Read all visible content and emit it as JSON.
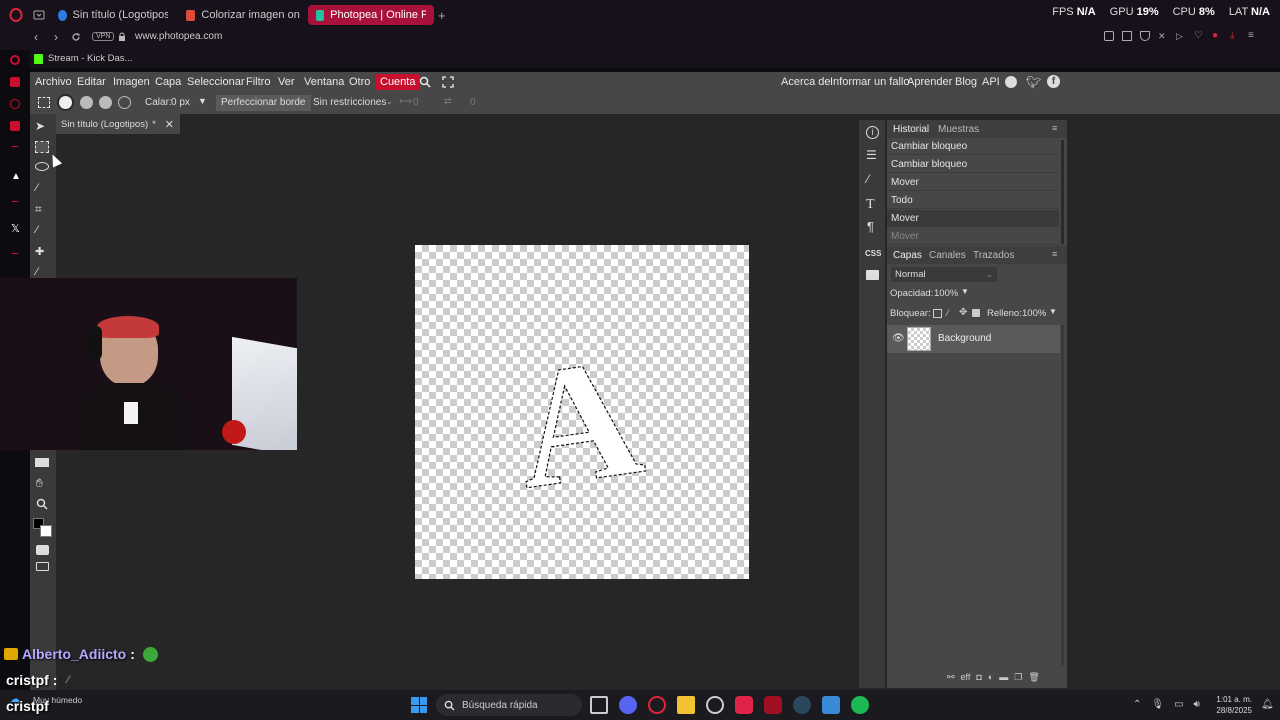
{
  "browser": {
    "tabs": [
      {
        "title": "Sin título (Logotipos) - Lo",
        "color": "#2d7de0"
      },
      {
        "title": "Colorizar imagen online",
        "color": "#e04a3a"
      },
      {
        "title": "Photopea | Online Photo E",
        "color": "#22c1a0"
      }
    ],
    "new_tab": "+",
    "vpn": "VPN",
    "url": "www.photopea.com",
    "bookmark": "Stream - Kick Das...",
    "stats": {
      "fps_label": "FPS",
      "fps": "N/A",
      "gpu_label": "GPU",
      "gpu": "19%",
      "cpu_label": "CPU",
      "cpu": "8%",
      "lat_label": "LAT",
      "lat": "N/A"
    }
  },
  "photopea": {
    "menu": [
      "Archivo",
      "Editar",
      "Imagen",
      "Capa",
      "Seleccionar",
      "Filtro",
      "Ver",
      "Ventana",
      "Otro"
    ],
    "account": "Cuenta",
    "right_links": [
      "Acerca de",
      "Informar un fallo",
      "Aprender",
      "Blog",
      "API"
    ],
    "options": {
      "feather_label": "Calar:",
      "feather_value": "0 px",
      "refine": "Perfeccionar borde",
      "constraint": "Sin restricciones",
      "w": "0",
      "h": "0"
    },
    "doc_tab": "Sin título (Logotipos)",
    "doc_modified": "*",
    "history": {
      "tabs": [
        "Historial",
        "Muestras"
      ],
      "items": [
        "Cambiar bloqueo",
        "Cambiar bloqueo",
        "Mover",
        "Todo",
        "Mover",
        "Mover"
      ]
    },
    "layers": {
      "tabs": [
        "Capas",
        "Canales",
        "Trazados"
      ],
      "blend": "Normal",
      "opacity_label": "Opacidad:",
      "opacity": "100%",
      "lock_label": "Bloquear:",
      "fill_label": "Relleno:",
      "fill": "100%",
      "layer_name": "Background"
    },
    "canvas_letter": "A",
    "accent": "#c8102e"
  },
  "chat": {
    "user1": "Alberto_Adiicto",
    "user1_sep": ":",
    "user2": "cristpf",
    "user2_sep": ":"
  },
  "taskbar": {
    "weather": "Muy húmedo",
    "search": "Búsqueda rápida",
    "time": "1:01 a. m.",
    "date": "28/8/2025"
  }
}
